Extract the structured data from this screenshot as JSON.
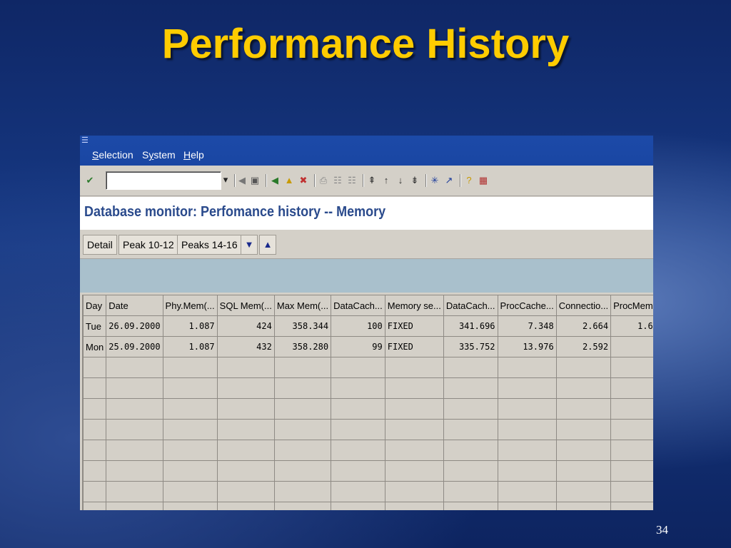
{
  "slide": {
    "title": "Performance History",
    "number": "34"
  },
  "menu": {
    "items": [
      {
        "pre": "",
        "u": "S",
        "post": "election"
      },
      {
        "pre": "S",
        "u": "y",
        "post": "stem"
      },
      {
        "pre": "",
        "u": "H",
        "post": "elp"
      }
    ]
  },
  "toolbar": {
    "command_value": ""
  },
  "screen_title": "Database monitor: Perfomance history -- Memory",
  "app_toolbar": {
    "detail": "Detail",
    "peak1": "Peak 10-12",
    "peaks2": "Peaks 14-16"
  },
  "grid": {
    "columns": [
      "Day",
      "Date",
      "Phy.Mem(...",
      "SQL Mem(...",
      "Max Mem(...",
      "DataCach...",
      "Memory se...",
      "DataCach...",
      "ProcCache...",
      "Connectio...",
      "ProcMem"
    ],
    "rows": [
      [
        "Tue",
        "26.09.2000",
        "1.087",
        "424",
        "358.344",
        "100",
        "FIXED",
        "341.696",
        "7.348",
        "2.664",
        "1.6"
      ],
      [
        "Mon",
        "25.09.2000",
        "1.087",
        "432",
        "358.280",
        "99",
        "FIXED",
        "335.752",
        "13.976",
        "2.592",
        ""
      ]
    ]
  }
}
